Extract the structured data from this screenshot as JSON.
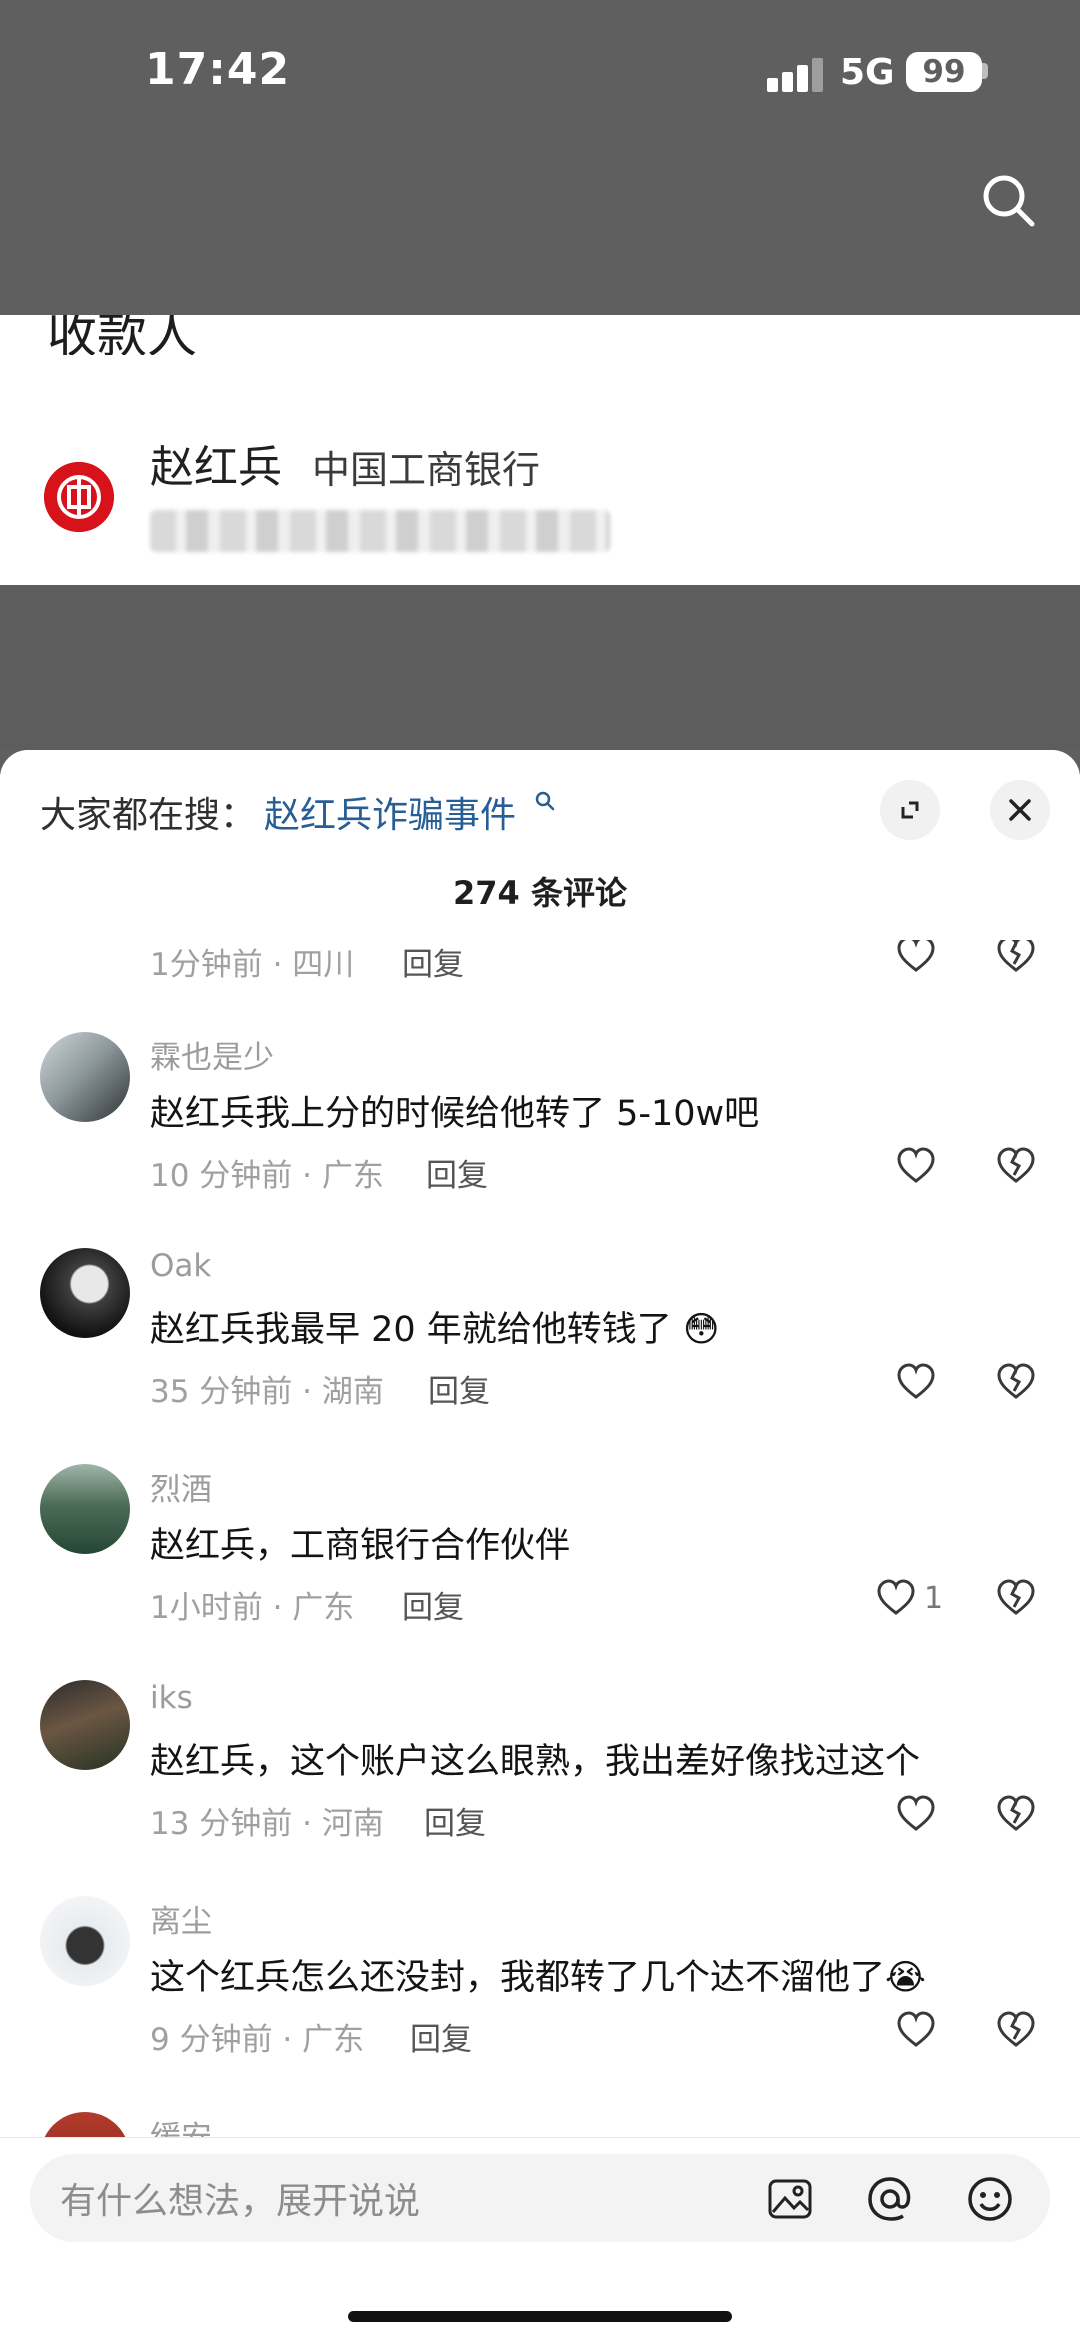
{
  "status_bar": {
    "time": "17:42",
    "network": "5G",
    "battery": "99"
  },
  "payee": {
    "title": "收款人",
    "name": "赵红兵",
    "bank": "中国工商银行"
  },
  "comments_panel": {
    "trend_prefix": "大家都在搜：",
    "trend_term": "赵红兵诈骗事件",
    "count_label": "274 条评论",
    "reply_label": "回复",
    "comments": [
      {
        "meta": "1分钟前 · 四川"
      },
      {
        "user": "霖也是少",
        "text": "赵红兵我上分的时候给他转了 5-10w吧",
        "meta": "10 分钟前 · 广东"
      },
      {
        "user": "Oak",
        "text": "赵红兵我最早 20 年就给他转钱了",
        "meta": "35 分钟前 · 湖南"
      },
      {
        "user": "烈酒",
        "text": "赵红兵，工商银行合作伙伴",
        "meta": "1小时前 · 广东",
        "likes": "1"
      },
      {
        "user": "iks",
        "text": "赵红兵，这个账户这么眼熟，我出差好像找过这个",
        "meta": "13 分钟前 · 河南"
      },
      {
        "user": "离尘",
        "text": "这个红兵怎么还没封，我都转了几个达不溜他了",
        "meta": "9 分钟前 · 广东"
      },
      {
        "user": "缓安"
      }
    ],
    "input_placeholder": "有什么想法，展开说说"
  }
}
